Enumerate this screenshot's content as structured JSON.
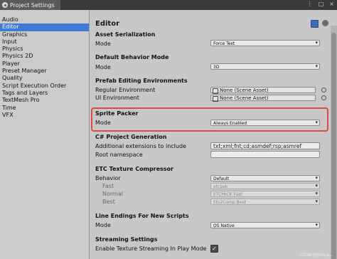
{
  "window": {
    "title": "Project Settings",
    "actions": [
      "⋮",
      "□",
      "×"
    ]
  },
  "sidebar": {
    "items": [
      {
        "label": "Audio",
        "selected": false
      },
      {
        "label": "Editor",
        "selected": true
      },
      {
        "label": "Graphics",
        "selected": false
      },
      {
        "label": "Input",
        "selected": false
      },
      {
        "label": "Physics",
        "selected": false
      },
      {
        "label": "Physics 2D",
        "selected": false
      },
      {
        "label": "Player",
        "selected": false
      },
      {
        "label": "Preset Manager",
        "selected": false
      },
      {
        "label": "Quality",
        "selected": false
      },
      {
        "label": "Script Execution Order",
        "selected": false
      },
      {
        "label": "Tags and Layers",
        "selected": false
      },
      {
        "label": "TextMesh Pro",
        "selected": false
      },
      {
        "label": "Time",
        "selected": false
      },
      {
        "label": "VFX",
        "selected": false
      }
    ]
  },
  "editor": {
    "title": "Editor",
    "asset_serialization": {
      "heading": "Asset Serialization",
      "mode_label": "Mode",
      "mode_value": "Force Text"
    },
    "default_behavior": {
      "heading": "Default Behavior Mode",
      "mode_label": "Mode",
      "mode_value": "3D"
    },
    "prefab": {
      "heading": "Prefab Editing Environments",
      "regular_label": "Regular Environment",
      "regular_value": "None (Scene Asset)",
      "ui_label": "UI Environment",
      "ui_value": "None (Scene Asset)"
    },
    "sprite_packer": {
      "heading": "Sprite Packer",
      "mode_label": "Mode",
      "mode_value": "Always Enabled"
    },
    "csharp": {
      "heading": "C# Project Generation",
      "extensions_label": "Additional extensions to include",
      "extensions_value": "txt;xml;fnt;cd;asmdef;rsp;asmref",
      "root_label": "Root namespace",
      "root_value": ""
    },
    "etc": {
      "heading": "ETC Texture Compressor",
      "behavior_label": "Behavior",
      "behavior_value": "Default",
      "fast_label": "Fast",
      "fast_value": "etcpak",
      "normal_label": "Normal",
      "normal_value": "ETCPACK Fast",
      "best_label": "Best",
      "best_value": "Etc2Comp Best"
    },
    "line_endings": {
      "heading": "Line Endings For New Scripts",
      "mode_label": "Mode",
      "mode_value": "OS Native"
    },
    "streaming": {
      "heading": "Streaming Settings",
      "enable_label": "Enable Texture Streaming In Play Mode",
      "enable_checked": true,
      "check_glyph": "✓"
    }
  },
  "watermark": "CSDN @Maya..."
}
